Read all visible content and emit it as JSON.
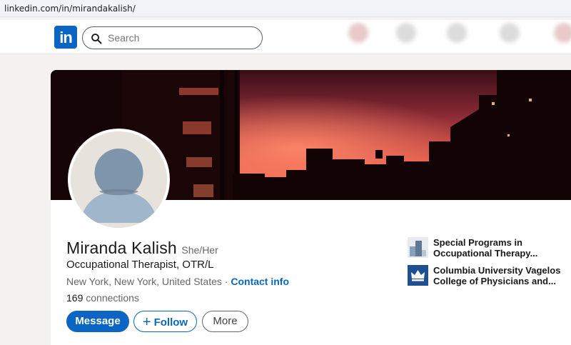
{
  "browser": {
    "url": "linkedin.com/in/mirandakalish/"
  },
  "topnav": {
    "logo_text": "in",
    "search_placeholder": "Search"
  },
  "profile": {
    "name": "Miranda Kalish",
    "pronouns": "She/Her",
    "headline": "Occupational Therapist, OTR/L",
    "location": "New York, New York, United States",
    "separator": "·",
    "contact_link": "Contact info",
    "connections_count": "169",
    "connections_label": "connections"
  },
  "actions": {
    "message": "Message",
    "follow": "Follow",
    "more": "More"
  },
  "experience": [
    {
      "line1": "Special Programs in",
      "line2": "Occupational Therapy...",
      "logo": "program-logo"
    },
    {
      "line1": "Columbia University Vagelos",
      "line2": "College of Physicians and...",
      "logo": "columbia-crown-logo"
    }
  ],
  "colors": {
    "brand": "#0a66c2",
    "sky_top": "#7a2430",
    "sky_glow": "#f0634f"
  }
}
